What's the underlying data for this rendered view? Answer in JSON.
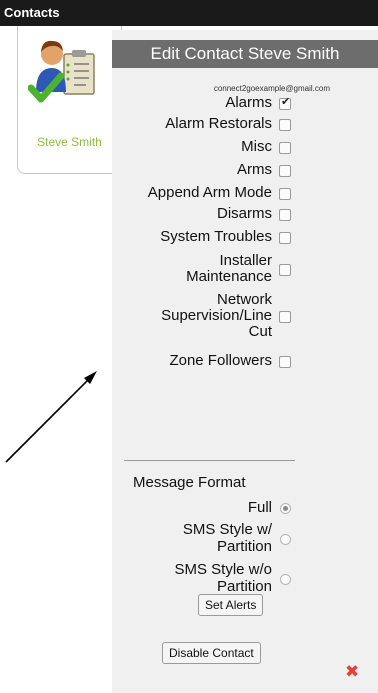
{
  "header": {
    "title": "Contacts"
  },
  "contact_card": {
    "name": "Steve Smith",
    "avatar_icon": "contact-person-icon"
  },
  "edit_panel": {
    "title": "Edit Contact Steve Smith",
    "email": "connect2goexample@gmail.com",
    "options": [
      {
        "lines": [
          "Alarms"
        ],
        "checked": true
      },
      {
        "lines": [
          "Alarm Restorals"
        ],
        "checked": false
      },
      {
        "lines": [
          "Misc"
        ],
        "checked": false
      },
      {
        "lines": [
          "Arms"
        ],
        "checked": false
      },
      {
        "lines": [
          "Append Arm Mode"
        ],
        "checked": false
      },
      {
        "lines": [
          "Disarms"
        ],
        "checked": false
      },
      {
        "lines": [
          "System Troubles"
        ],
        "checked": false
      },
      {
        "lines": [
          "Installer",
          "Maintenance"
        ],
        "checked": false
      },
      {
        "lines": [
          "Network",
          "Supervision/Line",
          "Cut"
        ],
        "checked": false
      },
      {
        "lines": [
          "Zone Followers"
        ],
        "checked": false
      }
    ],
    "message_format": {
      "label": "Message Format",
      "options": [
        {
          "lines": [
            "Full"
          ],
          "selected": true
        },
        {
          "lines": [
            "SMS Style w/",
            "Partition"
          ],
          "selected": false
        },
        {
          "lines": [
            "SMS Style w/o",
            "Partition"
          ],
          "selected": false
        }
      ]
    },
    "buttons": {
      "set_alerts": "Set Alerts",
      "disable_contact": "Disable Contact"
    },
    "close_icon": "close-x-icon"
  },
  "colors": {
    "header_bg": "#1a1a1a",
    "panel_header_bg": "#6d6d6d",
    "panel_bg": "#f0f0f0",
    "name_green": "#8fbf3a",
    "close_red": "#e0423a"
  }
}
